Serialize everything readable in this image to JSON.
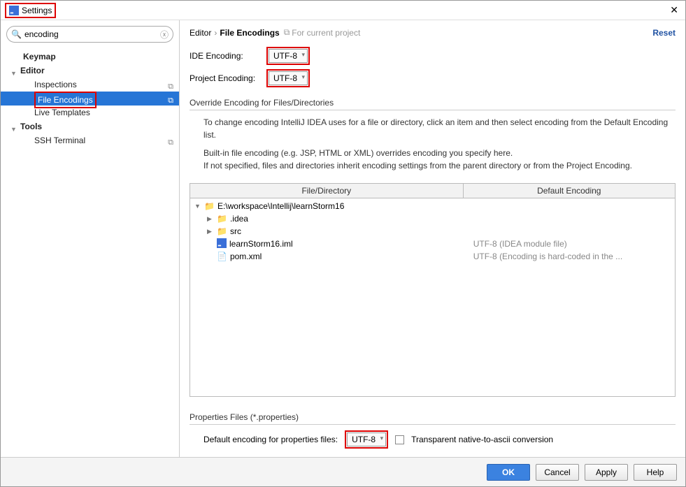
{
  "window": {
    "title": "Settings"
  },
  "search": {
    "value": "encoding",
    "placeholder": ""
  },
  "sidebar": {
    "items": [
      {
        "label": "Keymap",
        "level": 0,
        "arrow": "",
        "selected": false,
        "copy": false
      },
      {
        "label": "Editor",
        "level": 1,
        "arrow": "▼",
        "selected": false,
        "copy": false
      },
      {
        "label": "Inspections",
        "level": 2,
        "arrow": "",
        "selected": false,
        "copy": true
      },
      {
        "label": "File Encodings",
        "level": 2,
        "arrow": "",
        "selected": true,
        "copy": true,
        "highlight": true
      },
      {
        "label": "Live Templates",
        "level": 2,
        "arrow": "",
        "selected": false,
        "copy": false
      },
      {
        "label": "Tools",
        "level": 1,
        "arrow": "▼",
        "selected": false,
        "copy": false
      },
      {
        "label": "SSH Terminal",
        "level": 2,
        "arrow": "",
        "selected": false,
        "copy": true
      }
    ]
  },
  "main": {
    "breadcrumb_parent": "Editor",
    "breadcrumb_current": "File Encodings",
    "for_project": "For current project",
    "reset": "Reset",
    "ide_encoding_label": "IDE Encoding:",
    "ide_encoding_value": "UTF-8",
    "project_encoding_label": "Project Encoding:",
    "project_encoding_value": "UTF-8",
    "override_title": "Override Encoding for Files/Directories",
    "override_text1": "To change encoding IntelliJ IDEA uses for a file or directory, click an item and then select encoding from the Default Encoding list.",
    "override_text2": "Built-in file encoding (e.g. JSP, HTML or XML) overrides encoding you specify here.",
    "override_text3": "If not specified, files and directories inherit encoding settings from the parent directory or from the Project Encoding.",
    "table": {
      "col_fd": "File/Directory",
      "col_enc": "Default Encoding",
      "rows": [
        {
          "indent": 0,
          "tri": "▼",
          "icon": "folder",
          "name": "E:\\workspace\\Intellij\\learnStorm16",
          "enc": ""
        },
        {
          "indent": 1,
          "tri": "▶",
          "icon": "folder",
          "name": ".idea",
          "enc": ""
        },
        {
          "indent": 1,
          "tri": "▶",
          "icon": "folder",
          "name": "src",
          "enc": ""
        },
        {
          "indent": 1,
          "tri": "",
          "icon": "ij",
          "name": "learnStorm16.iml",
          "enc": "UTF-8 (IDEA module file)"
        },
        {
          "indent": 1,
          "tri": "",
          "icon": "xml",
          "name": "pom.xml",
          "enc": "UTF-8 (Encoding is hard-coded in the ..."
        }
      ]
    },
    "props_title": "Properties Files (*.properties)",
    "props_label": "Default encoding for properties files:",
    "props_value": "UTF-8",
    "props_checkbox": "Transparent native-to-ascii conversion"
  },
  "footer": {
    "ok": "OK",
    "cancel": "Cancel",
    "apply": "Apply",
    "help": "Help"
  }
}
